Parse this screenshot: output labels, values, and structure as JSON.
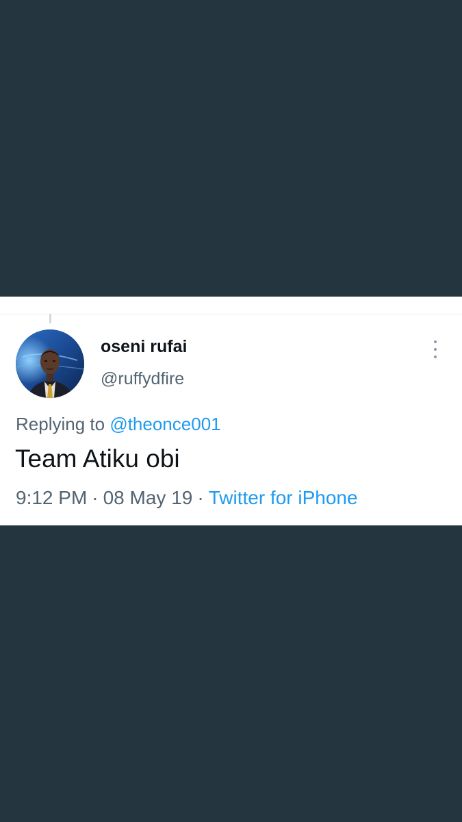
{
  "background_color": "#253540",
  "tweet": {
    "author": {
      "display_name": "oseni rufai",
      "handle": "@ruffydfire"
    },
    "avatar_icon": "profile-photo",
    "more_icon": "more-vertical-icon",
    "replying_to_prefix": "Replying to ",
    "replying_to_handle": "@theonce001",
    "text": "Team Atiku obi",
    "time": "9:12 PM",
    "separator": "·",
    "date": "08 May 19",
    "source": "Twitter for iPhone"
  },
  "colors": {
    "primary_text": "#0f1419",
    "secondary_text": "#536471",
    "link": "#1d9bf0",
    "card_background": "#ffffff"
  }
}
